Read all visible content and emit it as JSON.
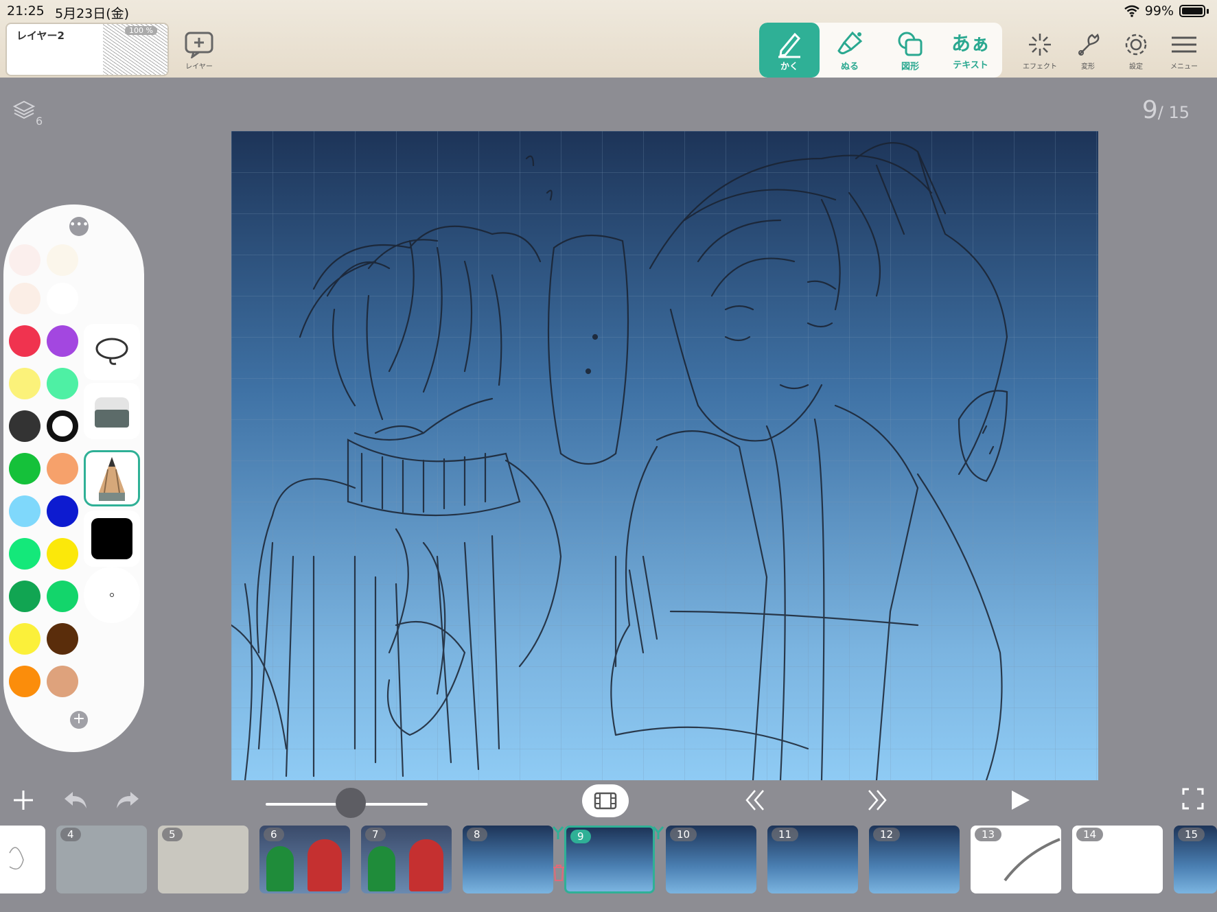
{
  "status": {
    "time": "21:25",
    "date": "5月23日(金)",
    "battery": "99%"
  },
  "layer_thumb": {
    "name": "レイヤー2",
    "opacity": "100 %"
  },
  "add_layer_label": "レイヤー",
  "tools": [
    {
      "label": "かく",
      "icon": "pen-icon",
      "active": true
    },
    {
      "label": "ぬる",
      "icon": "paint-brush-icon",
      "active": false
    },
    {
      "label": "図形",
      "icon": "shape-icon",
      "active": false
    },
    {
      "label": "テキスト",
      "icon": "text-icon",
      "glyph": "あぁ",
      "active": false
    }
  ],
  "top_right": [
    {
      "label": "エフェクト",
      "icon": "sparkle-icon"
    },
    {
      "label": "変形",
      "icon": "wrench-icon"
    },
    {
      "label": "設定",
      "icon": "gear-icon"
    },
    {
      "label": "メニュー",
      "icon": "hamburger-icon"
    }
  ],
  "layers_count": "6",
  "page": {
    "current": "9",
    "total": "/ 15"
  },
  "palette": {
    "more_glyph": "•••",
    "add_glyph": "+",
    "colors_left": [
      "#fbe3e0",
      "#fbeee6",
      "#f0334f",
      "#fbf27a",
      "#333333",
      "#15c13a",
      "#7fd8fb",
      "#14e87a",
      "#11a552",
      "#fbf03a",
      "#fb8d0b"
    ],
    "colors_right": [
      "#fcf2dc",
      "#ffffff",
      "#a347e0",
      "#4ef0a4",
      "ring",
      "#f6a16b",
      "#0d1bd0",
      "#fbe80a",
      "#13d56b",
      "#5a2d0b",
      "#dea27c"
    ]
  },
  "filmstrip": [
    {
      "num": "",
      "bg": "#ffffff",
      "kind": "sketch-white"
    },
    {
      "num": "4",
      "bg": "#9fa6ab",
      "kind": "gray"
    },
    {
      "num": "5",
      "bg": "#c9c7bf",
      "kind": "beige"
    },
    {
      "num": "6",
      "bg": "#41618d",
      "kind": "color"
    },
    {
      "num": "7",
      "bg": "#41618d",
      "kind": "color"
    },
    {
      "num": "8",
      "bg": "#4a7fb2",
      "kind": "blue"
    },
    {
      "num": "9",
      "bg": "#4a7fb2",
      "kind": "blue",
      "current": true
    },
    {
      "num": "10",
      "bg": "#4a7fb2",
      "kind": "blue"
    },
    {
      "num": "11",
      "bg": "#4a7fb2",
      "kind": "blue"
    },
    {
      "num": "12",
      "bg": "#4a7fb2",
      "kind": "blue"
    },
    {
      "num": "13",
      "bg": "#ffffff",
      "kind": "white"
    },
    {
      "num": "14",
      "bg": "#ffffff",
      "kind": "white"
    },
    {
      "num": "15",
      "bg": "#4a7fb2",
      "kind": "blue"
    }
  ]
}
